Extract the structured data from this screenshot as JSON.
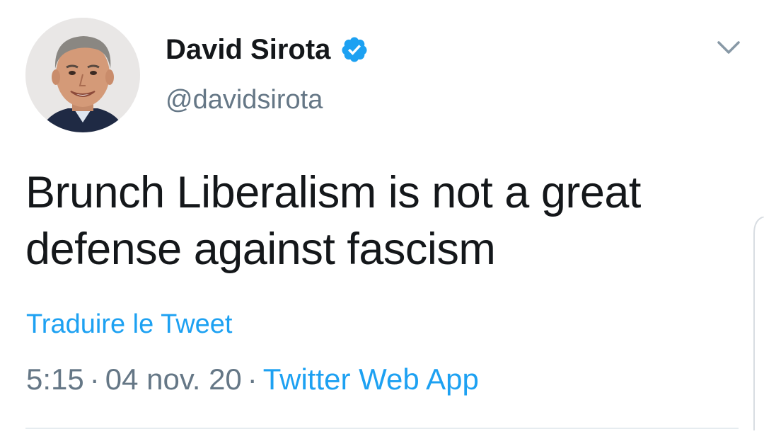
{
  "author": {
    "display_name": "David Sirota",
    "handle": "@davidsirota",
    "verified": true,
    "verified_badge_icon": "verified-badge-icon",
    "avatar": "profile-photo"
  },
  "tweet": {
    "text_line_1": "Brunch Liberalism is not a great",
    "text_line_2": "defense against fascism",
    "translate_label": "Traduire le Tweet"
  },
  "meta": {
    "time": "5:15",
    "separator": "·",
    "date": "04 nov. 20",
    "source": "Twitter Web App"
  },
  "menu": {
    "caret_icon": "chevron-down-icon"
  },
  "colors": {
    "accent": "#1da1f2",
    "text_primary": "#14171a",
    "text_secondary": "#657786",
    "divider": "#e6ecf0"
  }
}
